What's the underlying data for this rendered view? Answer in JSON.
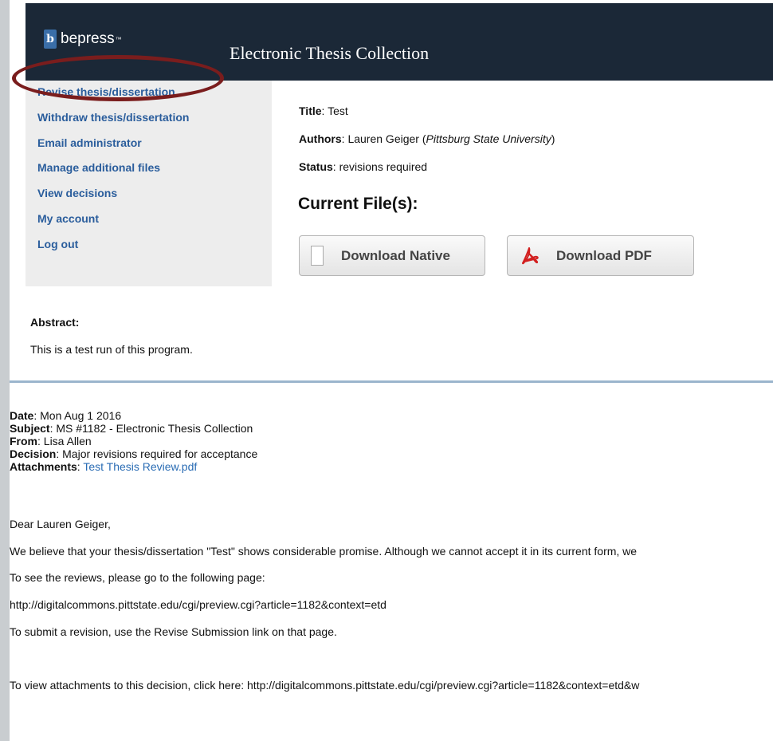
{
  "brand": {
    "logo_mark": "b",
    "logo_text": "bepress",
    "logo_tm": "™"
  },
  "header": {
    "title": "Electronic Thesis Collection"
  },
  "sidebar": {
    "items": [
      {
        "label": "Revise thesis/dissertation"
      },
      {
        "label": "Withdraw thesis/dissertation"
      },
      {
        "label": "Email administrator"
      },
      {
        "label": "Manage additional files"
      },
      {
        "label": "View decisions"
      },
      {
        "label": "My account"
      },
      {
        "label": "Log out"
      }
    ]
  },
  "details": {
    "title_label": "Title",
    "title_value": "Test",
    "authors_label": "Authors",
    "authors_value": "Lauren Geiger",
    "authors_institution": "Pittsburg State University",
    "status_label": "Status",
    "status_value": "revisions required",
    "current_files_heading": "Current File(s):",
    "download_native_label": "Download Native",
    "download_pdf_label": "Download PDF"
  },
  "abstract": {
    "label": "Abstract:",
    "text": "This is a test run of this program."
  },
  "email": {
    "date_label": "Date",
    "date_value": "Mon Aug 1 2016",
    "subject_label": "Subject",
    "subject_value": "MS #1182 - Electronic Thesis Collection",
    "from_label": "From",
    "from_value": "Lisa Allen",
    "decision_label": "Decision",
    "decision_value": "Major revisions required for acceptance",
    "attachments_label": "Attachments",
    "attachments_value": "Test Thesis Review.pdf",
    "greeting": "Dear Lauren Geiger,",
    "p1": "We believe that your thesis/dissertation \"Test\" shows considerable promise. Although we cannot accept it in its current form, we",
    "p2": "To see the reviews, please go to the following page:",
    "p3": "http://digitalcommons.pittstate.edu/cgi/preview.cgi?article=1182&context=etd",
    "p4": "To submit a revision, use the Revise Submission link on that page.",
    "p5": "To view attachments to this decision, click here: http://digitalcommons.pittstate.edu/cgi/preview.cgi?article=1182&context=etd&w"
  },
  "colors": {
    "header_bg": "#1b2837",
    "link": "#2a5d9c",
    "highlight_circle": "#7a1d1d",
    "divider": "#9bb5cd"
  }
}
